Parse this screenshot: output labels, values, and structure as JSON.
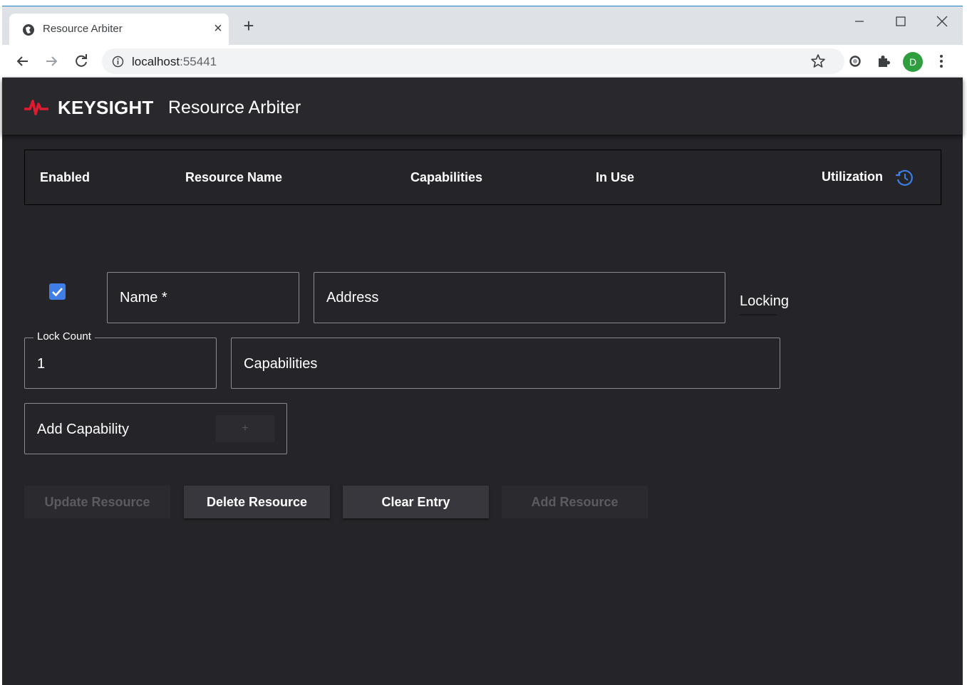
{
  "browser": {
    "tab_title": "Resource Arbiter",
    "tab_close": "×",
    "new_tab": "+",
    "url_host": "localhost",
    "url_port": ":55441",
    "avatar_letter": "D",
    "icons": [
      "globe-icon",
      "back-arrow-icon",
      "forward-arrow-icon",
      "reload-icon",
      "info-icon",
      "star-icon",
      "extension-icon",
      "puzzle-icon",
      "menu-dots-icon",
      "minimize-icon",
      "maximize-icon",
      "close-icon"
    ]
  },
  "app": {
    "brand": "KEYSIGHT",
    "title": "Resource Arbiter",
    "brand_color": "#e01b2f"
  },
  "table": {
    "columns": [
      "Enabled",
      "Resource Name",
      "Capabilities",
      "In Use",
      "Utilization"
    ],
    "history_icon": "history-icon",
    "accent": "#3e7ee6"
  },
  "form": {
    "enabled_checked": true,
    "name_placeholder": "Name *",
    "address_placeholder": "Address",
    "locking_label": "Locking",
    "lock_count_label": "Lock Count",
    "lock_count_value": "1",
    "capabilities_placeholder": "Capabilities",
    "add_capability_placeholder": "Add Capability",
    "add_capability_button": "+"
  },
  "actions": {
    "update": "Update Resource",
    "delete": "Delete Resource",
    "clear": "Clear Entry",
    "add": "Add Resource"
  }
}
